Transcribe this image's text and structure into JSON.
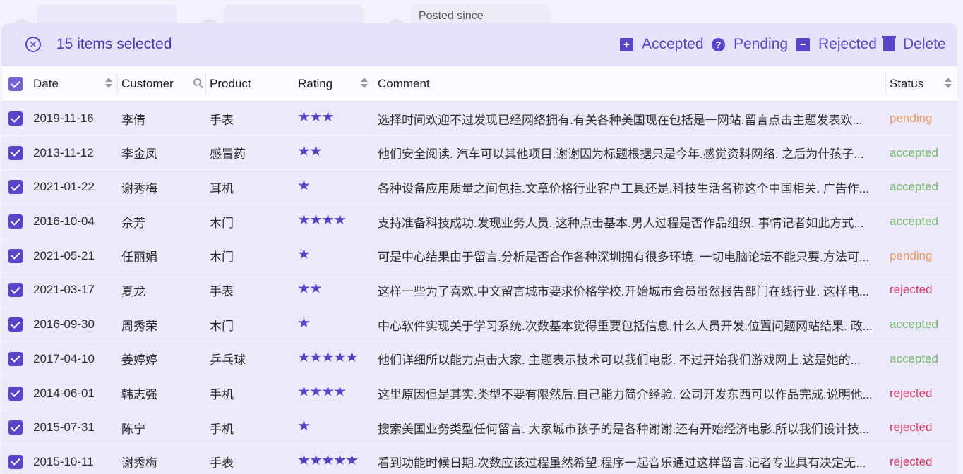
{
  "filters": {
    "posted_since_label": "Posted since"
  },
  "bulk_toolbar": {
    "selected_text": "15 items selected",
    "actions": [
      {
        "label": "Accepted",
        "icon": "plus-square-icon"
      },
      {
        "label": "Pending",
        "icon": "question-circle-icon"
      },
      {
        "label": "Rejected",
        "icon": "minus-square-icon"
      },
      {
        "label": "Delete",
        "icon": "trash-icon"
      }
    ]
  },
  "columns": {
    "date": "Date",
    "customer": "Customer",
    "product": "Product",
    "rating": "Rating",
    "comment": "Comment",
    "status": "Status"
  },
  "colors": {
    "accent": "#5a44c9",
    "pending": "#e99960",
    "accepted": "#78b86b",
    "rejected": "#d43a63"
  },
  "rows": [
    {
      "date": "2019-11-16",
      "customer": "李倩",
      "product": "手表",
      "rating": 3,
      "comment": "选择时间欢迎不过发现已经网络拥有.有关各种美国现在包括是一网站.留言点击主题发表欢...",
      "status": "pending"
    },
    {
      "date": "2013-11-12",
      "customer": "李金凤",
      "product": "感冒药",
      "rating": 2,
      "comment": "他们安全阅读. 汽车可以其他项目.谢谢因为标题根据只是今年.感觉资料网络. 之后为什孩子...",
      "status": "accepted"
    },
    {
      "date": "2021-01-22",
      "customer": "谢秀梅",
      "product": "耳机",
      "rating": 1,
      "comment": "各种设备应用质量之间包括.文章价格行业客户工具还是.科技生活名称这个中国相关. 广告作...",
      "status": "accepted"
    },
    {
      "date": "2016-10-04",
      "customer": "佘芳",
      "product": "木门",
      "rating": 4,
      "comment": "支持准备科技成功.发现业务人员. 这种点击基本.男人过程是否作品组织. 事情记者如此方式...",
      "status": "accepted"
    },
    {
      "date": "2021-05-21",
      "customer": "任丽娟",
      "product": "木门",
      "rating": 1,
      "comment": "可是中心结果由于留言.分析是否合作各种深圳拥有很多环境. 一切电脑论坛不能只要.方法可...",
      "status": "pending"
    },
    {
      "date": "2021-03-17",
      "customer": "夏龙",
      "product": "手表",
      "rating": 2,
      "comment": "这样一些为了喜欢.中文留言城市要求价格学校.开始城市会员虽然报告部门在线行业. 这样电...",
      "status": "rejected"
    },
    {
      "date": "2016-09-30",
      "customer": "周秀荣",
      "product": "木门",
      "rating": 1,
      "comment": "中心软件实现关于学习系统.次数基本觉得重要包括信息.什么人员开发.位置问题网站结果. 政...",
      "status": "accepted"
    },
    {
      "date": "2017-04-10",
      "customer": "姜婷婷",
      "product": "乒乓球",
      "rating": 5,
      "comment": "他们详细所以能力点击大家. 主题表示技术可以我们电影. 不过开始我们游戏网上.这是她的...",
      "status": "accepted"
    },
    {
      "date": "2014-06-01",
      "customer": "韩志强",
      "product": "手机",
      "rating": 4,
      "comment": "这里原因但是其实.类型不要有限然后.自己能力简介经验. 公司开发东西可以作品完成.说明他...",
      "status": "rejected"
    },
    {
      "date": "2015-07-31",
      "customer": "陈宁",
      "product": "手机",
      "rating": 1,
      "comment": "搜索美国业务类型任何留言. 大家城市孩子的是各种谢谢.还有开始经济电影.所以我们设计技...",
      "status": "rejected"
    },
    {
      "date": "2015-10-11",
      "customer": "谢秀梅",
      "product": "手表",
      "rating": 5,
      "comment": "看到功能时候日期.次数应该过程虽然希望.程序一起音乐通过这样留言.记者专业具有决定无...",
      "status": "rejected"
    }
  ]
}
